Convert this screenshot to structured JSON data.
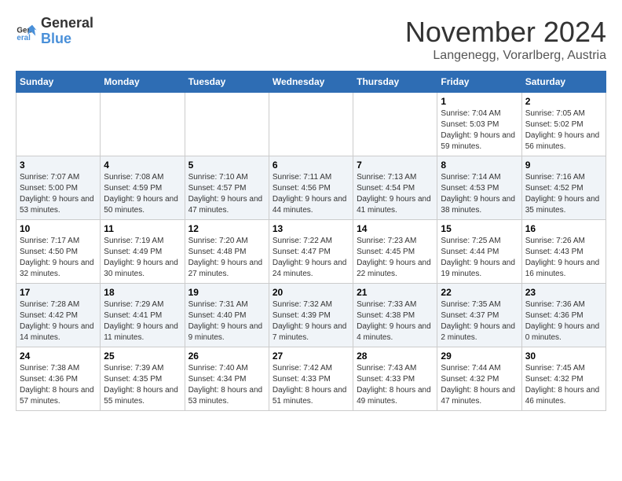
{
  "logo": {
    "line1": "General",
    "line2": "Blue"
  },
  "title": "November 2024",
  "location": "Langenegg, Vorarlberg, Austria",
  "weekdays": [
    "Sunday",
    "Monday",
    "Tuesday",
    "Wednesday",
    "Thursday",
    "Friday",
    "Saturday"
  ],
  "weeks": [
    [
      {
        "day": "",
        "info": ""
      },
      {
        "day": "",
        "info": ""
      },
      {
        "day": "",
        "info": ""
      },
      {
        "day": "",
        "info": ""
      },
      {
        "day": "",
        "info": ""
      },
      {
        "day": "1",
        "info": "Sunrise: 7:04 AM\nSunset: 5:03 PM\nDaylight: 9 hours and 59 minutes."
      },
      {
        "day": "2",
        "info": "Sunrise: 7:05 AM\nSunset: 5:02 PM\nDaylight: 9 hours and 56 minutes."
      }
    ],
    [
      {
        "day": "3",
        "info": "Sunrise: 7:07 AM\nSunset: 5:00 PM\nDaylight: 9 hours and 53 minutes."
      },
      {
        "day": "4",
        "info": "Sunrise: 7:08 AM\nSunset: 4:59 PM\nDaylight: 9 hours and 50 minutes."
      },
      {
        "day": "5",
        "info": "Sunrise: 7:10 AM\nSunset: 4:57 PM\nDaylight: 9 hours and 47 minutes."
      },
      {
        "day": "6",
        "info": "Sunrise: 7:11 AM\nSunset: 4:56 PM\nDaylight: 9 hours and 44 minutes."
      },
      {
        "day": "7",
        "info": "Sunrise: 7:13 AM\nSunset: 4:54 PM\nDaylight: 9 hours and 41 minutes."
      },
      {
        "day": "8",
        "info": "Sunrise: 7:14 AM\nSunset: 4:53 PM\nDaylight: 9 hours and 38 minutes."
      },
      {
        "day": "9",
        "info": "Sunrise: 7:16 AM\nSunset: 4:52 PM\nDaylight: 9 hours and 35 minutes."
      }
    ],
    [
      {
        "day": "10",
        "info": "Sunrise: 7:17 AM\nSunset: 4:50 PM\nDaylight: 9 hours and 32 minutes."
      },
      {
        "day": "11",
        "info": "Sunrise: 7:19 AM\nSunset: 4:49 PM\nDaylight: 9 hours and 30 minutes."
      },
      {
        "day": "12",
        "info": "Sunrise: 7:20 AM\nSunset: 4:48 PM\nDaylight: 9 hours and 27 minutes."
      },
      {
        "day": "13",
        "info": "Sunrise: 7:22 AM\nSunset: 4:47 PM\nDaylight: 9 hours and 24 minutes."
      },
      {
        "day": "14",
        "info": "Sunrise: 7:23 AM\nSunset: 4:45 PM\nDaylight: 9 hours and 22 minutes."
      },
      {
        "day": "15",
        "info": "Sunrise: 7:25 AM\nSunset: 4:44 PM\nDaylight: 9 hours and 19 minutes."
      },
      {
        "day": "16",
        "info": "Sunrise: 7:26 AM\nSunset: 4:43 PM\nDaylight: 9 hours and 16 minutes."
      }
    ],
    [
      {
        "day": "17",
        "info": "Sunrise: 7:28 AM\nSunset: 4:42 PM\nDaylight: 9 hours and 14 minutes."
      },
      {
        "day": "18",
        "info": "Sunrise: 7:29 AM\nSunset: 4:41 PM\nDaylight: 9 hours and 11 minutes."
      },
      {
        "day": "19",
        "info": "Sunrise: 7:31 AM\nSunset: 4:40 PM\nDaylight: 9 hours and 9 minutes."
      },
      {
        "day": "20",
        "info": "Sunrise: 7:32 AM\nSunset: 4:39 PM\nDaylight: 9 hours and 7 minutes."
      },
      {
        "day": "21",
        "info": "Sunrise: 7:33 AM\nSunset: 4:38 PM\nDaylight: 9 hours and 4 minutes."
      },
      {
        "day": "22",
        "info": "Sunrise: 7:35 AM\nSunset: 4:37 PM\nDaylight: 9 hours and 2 minutes."
      },
      {
        "day": "23",
        "info": "Sunrise: 7:36 AM\nSunset: 4:36 PM\nDaylight: 9 hours and 0 minutes."
      }
    ],
    [
      {
        "day": "24",
        "info": "Sunrise: 7:38 AM\nSunset: 4:36 PM\nDaylight: 8 hours and 57 minutes."
      },
      {
        "day": "25",
        "info": "Sunrise: 7:39 AM\nSunset: 4:35 PM\nDaylight: 8 hours and 55 minutes."
      },
      {
        "day": "26",
        "info": "Sunrise: 7:40 AM\nSunset: 4:34 PM\nDaylight: 8 hours and 53 minutes."
      },
      {
        "day": "27",
        "info": "Sunrise: 7:42 AM\nSunset: 4:33 PM\nDaylight: 8 hours and 51 minutes."
      },
      {
        "day": "28",
        "info": "Sunrise: 7:43 AM\nSunset: 4:33 PM\nDaylight: 8 hours and 49 minutes."
      },
      {
        "day": "29",
        "info": "Sunrise: 7:44 AM\nSunset: 4:32 PM\nDaylight: 8 hours and 47 minutes."
      },
      {
        "day": "30",
        "info": "Sunrise: 7:45 AM\nSunset: 4:32 PM\nDaylight: 8 hours and 46 minutes."
      }
    ]
  ]
}
